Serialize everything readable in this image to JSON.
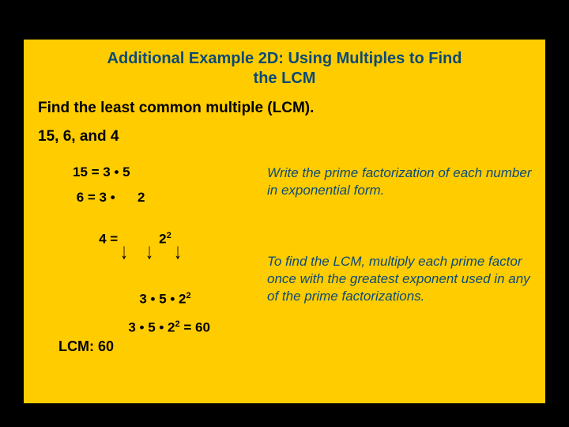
{
  "title_line1": "Additional Example 2D: Using Multiples to Find",
  "title_line2": "the LCM",
  "subtitle": "Find the least common multiple (LCM).",
  "numbers": "15, 6, and 4",
  "fact": {
    "r1_left": "15 = 3 • 5",
    "r2_left": " 6 = 3 •      2",
    "r3_left": " 4 =           2",
    "r3_exp": "2"
  },
  "expl1": "Write the prime factorization of each number in exponential form.",
  "mult": {
    "line1a": "3 • 5 • 2",
    "line1exp": "2",
    "line2a": "3 • 5 • 2",
    "line2exp": "2",
    "line2b": " = 60"
  },
  "expl2": "To find the LCM, multiply each prime factor once with the greatest exponent used in any of the prime factorizations.",
  "result": "LCM: 60",
  "chart_data": {
    "type": "table",
    "title": "Prime factorizations and LCM computation",
    "rows": [
      {
        "n": 15,
        "factorization": "3 · 5"
      },
      {
        "n": 6,
        "factorization": "3 · 2"
      },
      {
        "n": 4,
        "factorization": "2^2"
      }
    ],
    "lcm_expression": "3 · 5 · 2^2",
    "lcm_value": 60
  }
}
